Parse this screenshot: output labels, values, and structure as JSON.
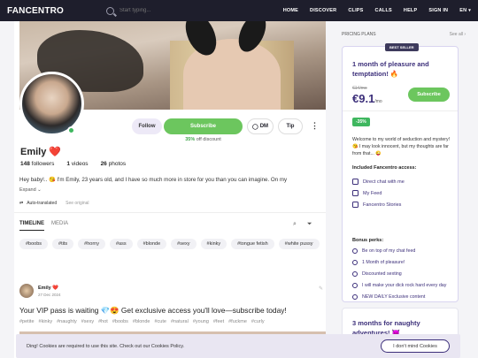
{
  "header": {
    "logo": "FANCENTRO",
    "search_placeholder": "Start typing...",
    "nav": [
      "HOME",
      "DISCOVER",
      "CLIPS",
      "CALLS",
      "HELP",
      "SIGN IN",
      "EN"
    ]
  },
  "profile": {
    "follow_label": "Follow",
    "subscribe_label": "Subscribe",
    "discount_pct": "35%",
    "discount_text": "off discount",
    "dm_label": "DM",
    "tip_label": "Tip",
    "name": "Emily",
    "heart": "❤️",
    "followers": "148",
    "followers_label": "followers",
    "videos": "1",
    "videos_label": "videos",
    "photos": "26",
    "photos_label": "photos",
    "bio": "Hey baby!.. 😘 I'm Emily, 23 years old, and I have so much more in store for you than you can imagine. On my",
    "expand_label": "Expand ⌄",
    "translated_label": "Auto-translated",
    "see_original_label": "See original"
  },
  "tabs": [
    "TIMELINE",
    "MEDIA"
  ],
  "tags": [
    "#boobs",
    "#tits",
    "#horny",
    "#ass",
    "#blonde",
    "#sexy",
    "#kinky",
    "#tongue fetish",
    "#white pussy"
  ],
  "post": {
    "author": "Emily ❤️",
    "date": "27 Dec 2024",
    "text": "Your VIP pass is waiting 💎😍 Get exclusive access you'll love—subscribe today!",
    "hashtags": [
      "#petite",
      "#kinky",
      "#naughty",
      "#sexy",
      "#hot",
      "#boobs",
      "#blonde",
      "#cute",
      "#natural",
      "#young",
      "#feet",
      "#fuckme",
      "#curly"
    ]
  },
  "sidebar": {
    "heading": "PRICING PLANS",
    "see_all": "See all ›",
    "plan1": {
      "badge": "BEST SELLER",
      "title": "1 month of pleasure and temptation! 🔥",
      "old_price": "€14",
      "old_price_unit": "/mo",
      "price": "€9.1",
      "price_unit": "/mo",
      "subscribe_label": "Subscribe",
      "discount_badge": "-35%",
      "description": "Welcome to my world of seduction and mystery! 😘 I may look innocent, but my thoughts are far from that... 😜",
      "includes_title": "Included Fancentro access:",
      "includes": [
        "Direct chat with me",
        "My Feed",
        "Fancentro Stories"
      ],
      "perks_title": "Bonus perks:",
      "perks": [
        "Be on top of my chat feed",
        "1 Month of pleasure!",
        "Discounted sexting",
        "I will make your dick rock hard every day",
        "NEW DAILY Exclusive content"
      ]
    },
    "plan2": {
      "title": "3 months for naughty adventures! 😈"
    }
  },
  "cookie": {
    "text": "Ding! Cookies are required to use this site. Check out our Cookies Policy.",
    "button": "I don't mind Cookies"
  },
  "colors": {
    "topbar": "#1e1e2c",
    "accent_purple": "#3c2f7a",
    "subscribe_green": "#6cc65e"
  }
}
